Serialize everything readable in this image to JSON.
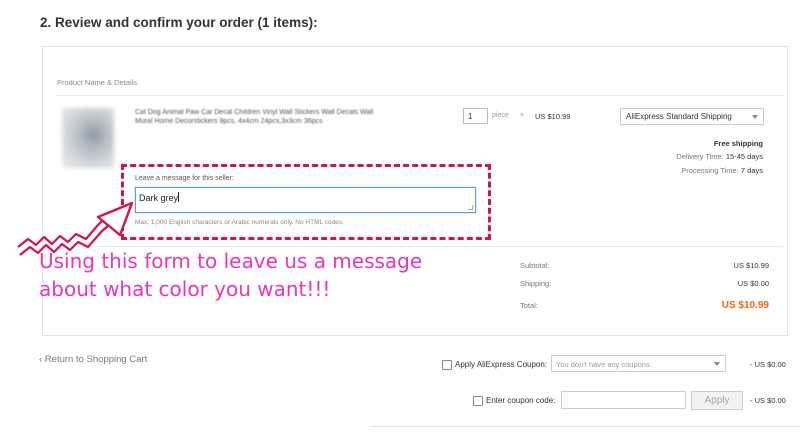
{
  "heading": "2. Review and confirm your order (1 items):",
  "table": {
    "column_header": "Product Name & Details"
  },
  "product": {
    "thumbnail_icon": "product-thumbnail",
    "title": "Cat Dog Animal Paw Car Decal Children Vinyl Wall Stickers Wall Decals Wall Mural Home Decorstickers 9pcs, 4x4cm 24pcs,3x3cm 36pcs",
    "quantity": "1",
    "unit": "piece",
    "times": "×",
    "price": "US $10.99",
    "shipping_method": "AliExpress Standard Shipping",
    "free_shipping": "Free shipping",
    "delivery_label": "Delivery Time:",
    "delivery_value": "15-45 days",
    "processing_label": "Processing Time:",
    "processing_value": "7 days"
  },
  "message": {
    "label": "Leave a message for this seller:",
    "value": "Dark grey",
    "hint": "Max. 1,000 English characters or Arabic numerals only. No HTML codes."
  },
  "annotation": {
    "line1": "Using this form to leave us a message",
    "line2": "about what color you want!!!",
    "color": "#ea35b8",
    "box_color": "#d0154d"
  },
  "summary": {
    "subtotal_label": "Subtotal:",
    "subtotal_value": "US $10.99",
    "shipping_label": "Shipping:",
    "shipping_value": "US $0.00",
    "total_label": "Total:",
    "total_value": "US $10.99",
    "total_color": "#e36b0c"
  },
  "footer": {
    "back_link": "‹ Return to Shopping Cart",
    "coupon_label": "Apply AliExpress Coupon:",
    "coupon_placeholder": "You don't have any coupons",
    "coupon_discount": "- US $0.00",
    "code_label": "Enter coupon code:",
    "code_value": "",
    "apply_label": "Apply",
    "code_discount": "- US $0.00"
  }
}
